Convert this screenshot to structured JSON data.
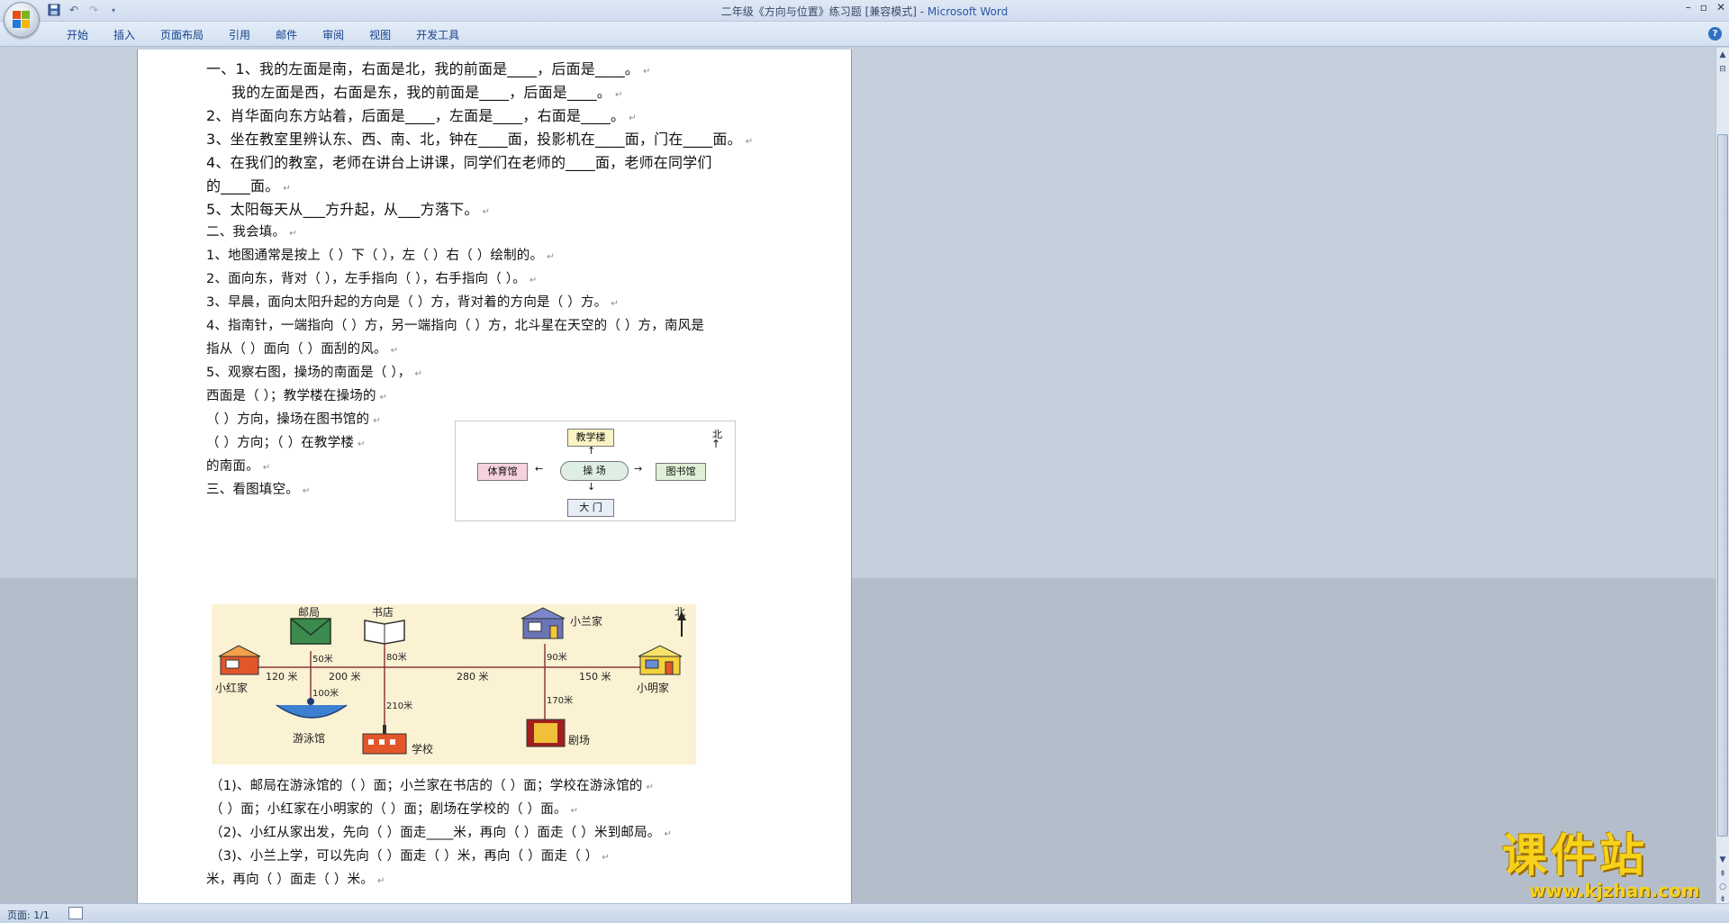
{
  "window": {
    "title": "二年级《方向与位置》练习题 [兼容模式] - ",
    "app_name": "Microsoft Word",
    "controls": [
      "–",
      "▫",
      "✕"
    ]
  },
  "quick_access": [
    "save",
    "undo",
    "redo",
    "customize"
  ],
  "ribbon": {
    "tabs": [
      "开始",
      "插入",
      "页面布局",
      "引用",
      "邮件",
      "审阅",
      "视图",
      "开发工具"
    ],
    "help": "?"
  },
  "document": {
    "lines": [
      "一、1、我的左面是南，右面是北，我的前面是____，后面是____。",
      "    我的左面是西，右面是东，我的前面是____，后面是____。",
      "2、肖华面向东方站着，后面是____，左面是____，右面是____。",
      "3、坐在教室里辨认东、西、南、北，钟在____面，投影机在____面，门在____面。",
      "4、在我们的教室，老师在讲台上讲课，同学们在老师的____面，老师在同学们",
      "的____面。",
      "5、太阳每天从___方升起，从___方落下。",
      "二、我会填。",
      "1、地图通常是按上（      ）下（      ），左（      ）右（      ）绘制的。",
      "2、面向东，背对（      ），左手指向（        ），右手指向（        ）。",
      "3、早晨，面向太阳升起的方向是（        ）方，背对着的方向是（       ）方。",
      "4、指南针，一端指向（ ）方，另一端指向（      ）方，北斗星在天空的（      ）方，南风是",
      "指从（   ）面向（       ）面刮的风。",
      "5、观察右图，操场的南面是（        ），",
      "    西面是（        ）；教学楼在操场的",
      "    （            ）方向，操场在图书馆的",
      "    （            ）方向；（            ）在教学楼",
      "    的南面。",
      "三、看图填空。",
      "（1)、邮局在游泳馆的（     ）面；小兰家在书店的（     ）面；学校在游泳馆的",
      "（     ）面；小红家在小明家的（      ）面；剧场在学校的（      ）面。",
      "（2)、小红从家出发，先向（      ）面走____米，再向（      ）面走（      ）米到邮局。",
      "（3)、小兰上学，可以先向（       ）面走（       ）米，再向（        ）面走（        ）",
      "米，再向（          ）面走（         ）米。"
    ],
    "paragraph_mark": "↵"
  },
  "diagram_direction": {
    "north": "北",
    "center": "操  场",
    "top": "教学楼",
    "left": "体育馆",
    "right": "图书馆",
    "bottom": "大 门",
    "colors": {
      "top": "#fbf3c4",
      "left": "#f6d2dc",
      "right": "#dff0d6",
      "bottom": "#e7eef7",
      "center": "#dfeee4"
    }
  },
  "map": {
    "labels": {
      "post_office": "邮局",
      "bookstore": "书店",
      "xiaolan_home": "小兰家",
      "north": "北",
      "xiaohong_home": "小红家",
      "xiaoming_home": "小明家",
      "pool": "游泳馆",
      "school": "学校",
      "theater": "剧场"
    },
    "distances": {
      "d120": "120 米",
      "d200": "200 米",
      "d280": "280 米",
      "d150": "150 米",
      "d50": "50米",
      "d100": "100米",
      "d80": "80米",
      "d90": "90米",
      "d210": "210米",
      "d170": "170米"
    }
  },
  "status": {
    "page": "页面: 1/1"
  },
  "watermark": {
    "main": "课件站",
    "sub": "www.kjzhan.com"
  }
}
